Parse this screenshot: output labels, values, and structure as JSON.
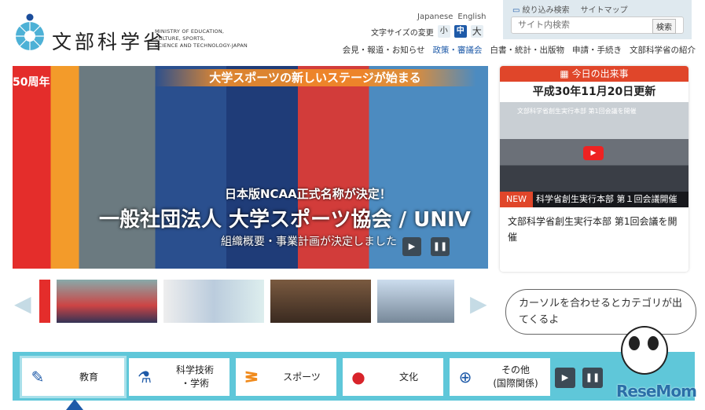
{
  "logo": {
    "jp": "文部科学省",
    "en": [
      "MINISTRY OF EDUCATION,",
      "CULTURE, SPORTS,",
      "SCIENCE AND TECHNOLOGY-JAPAN"
    ]
  },
  "lang": {
    "japanese": "Japanese",
    "english": "English"
  },
  "font_size": {
    "label": "文字サイズの変更",
    "small": "小",
    "medium": "中",
    "large": "大"
  },
  "search": {
    "filter": "絞り込み検索",
    "sitemap": "サイトマップ",
    "placeholder": "サイト内検索",
    "button": "検索"
  },
  "gnav": [
    "会見・報道・お知らせ",
    "政策・審議会",
    "白書・統計・出版物",
    "申請・手続き",
    "文部科学省の紹介"
  ],
  "hero": {
    "top": "大学スポーツの新しいステージが始まる",
    "anniv": "50周年",
    "sub1": "日本版NCAA正式名称が決定！",
    "main": "一般社団法人 大学スポーツ協会 / UNIV",
    "sub2": "組織概要・事業計画が決定しました"
  },
  "today": {
    "header": "今日の出来事",
    "date": "平成30年11月20日更新",
    "video_title": "文部科学省創生実行本部 第1回会議を開催",
    "caption": "科学省創生実行本部 第１回会議開催",
    "badge": "NEW",
    "text": "文部科学省創生実行本部 第1回会議を開催"
  },
  "bubble": "カーソルを合わせるとカテゴリが出てくるよ",
  "categories": [
    {
      "label": "教育"
    },
    {
      "label": "科学技術\n・学術"
    },
    {
      "label": "スポーツ"
    },
    {
      "label": "文化"
    },
    {
      "label": "その他\n(国際関係)"
    }
  ],
  "watermark": "ReseMom",
  "colors": {
    "accent": "#1e5aa8",
    "today_red": "#e0462a",
    "catbar": "#5fc7d9"
  }
}
